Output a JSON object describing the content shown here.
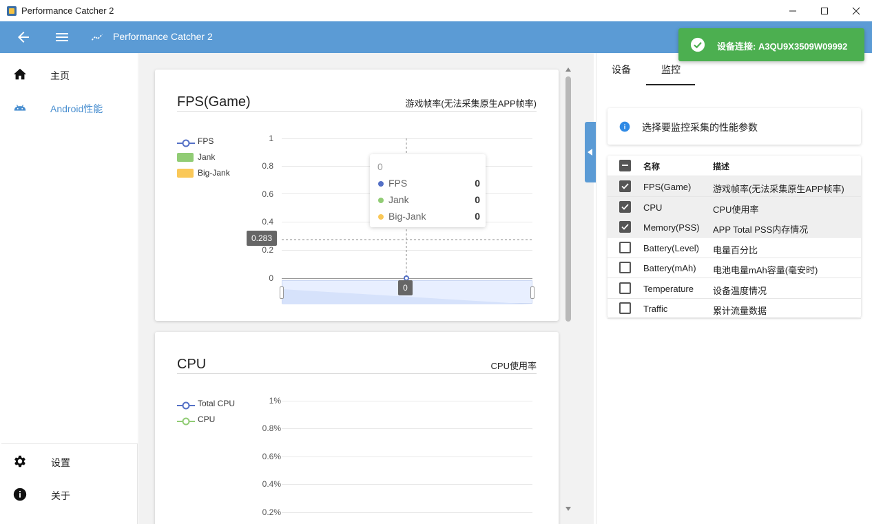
{
  "window": {
    "title": "Performance Catcher 2"
  },
  "appbar": {
    "title": "Performance Catcher 2"
  },
  "sidebar": {
    "items": [
      {
        "label": "主页",
        "icon": "home-icon"
      },
      {
        "label": "Android性能",
        "icon": "android-icon"
      }
    ],
    "bottom_items": [
      {
        "label": "设置",
        "icon": "gear-icon"
      },
      {
        "label": "关于",
        "icon": "info-icon"
      }
    ]
  },
  "fps_card": {
    "title": "FPS(Game)",
    "subtitle": "游戏帧率(无法采集原生APP帧率)",
    "legend": [
      "FPS",
      "Jank",
      "Big-Jank"
    ],
    "tooltip": {
      "header": "0",
      "rows": [
        {
          "name": "FPS",
          "value": "0"
        },
        {
          "name": "Jank",
          "value": "0"
        },
        {
          "name": "Big-Jank",
          "value": "0"
        }
      ]
    },
    "y_pointer_label": "0.283",
    "x_pointer_label": "0"
  },
  "cpu_card": {
    "title": "CPU",
    "subtitle": "CPU使用率",
    "legend": [
      "Total CPU",
      "CPU"
    ]
  },
  "chart_data": [
    {
      "type": "line",
      "title": "FPS(Game)",
      "subtitle": "游戏帧率(无法采集原生APP帧率)",
      "ylim": [
        0,
        1
      ],
      "yticks": [
        "1",
        "0.8",
        "0.6",
        "0.4",
        "0.2",
        "0"
      ],
      "series": [
        {
          "name": "FPS",
          "values": [
            0
          ]
        },
        {
          "name": "Jank",
          "values": [
            0
          ]
        },
        {
          "name": "Big-Jank",
          "values": [
            0
          ]
        }
      ],
      "x": [
        "0"
      ]
    },
    {
      "type": "line",
      "title": "CPU",
      "subtitle": "CPU使用率",
      "ylim": [
        0,
        1
      ],
      "yticks": [
        "1%",
        "0.8%",
        "0.6%",
        "0.4%",
        "0.2%"
      ],
      "series": [
        {
          "name": "Total CPU",
          "values": []
        },
        {
          "name": "CPU",
          "values": []
        }
      ]
    }
  ],
  "right_panel": {
    "tabs": [
      "设备",
      "监控"
    ],
    "active_tab": "监控",
    "info_text": "选择要监控采集的性能参数",
    "table": {
      "headers": {
        "name": "名称",
        "desc": "描述"
      },
      "rows": [
        {
          "name": "FPS(Game)",
          "desc": "游戏帧率(无法采集原生APP帧率)",
          "checked": true
        },
        {
          "name": "CPU",
          "desc": "CPU使用率",
          "checked": true
        },
        {
          "name": "Memory(PSS)",
          "desc": "APP Total PSS内存情况",
          "checked": true
        },
        {
          "name": "Battery(Level)",
          "desc": "电量百分比",
          "checked": false
        },
        {
          "name": "Battery(mAh)",
          "desc": "电池电量mAh容量(毫安时)",
          "checked": false
        },
        {
          "name": "Temperature",
          "desc": "设备温度情况",
          "checked": false
        },
        {
          "name": "Traffic",
          "desc": "累计流量数据",
          "checked": false
        }
      ]
    }
  },
  "toast": {
    "text": "设备连接: A3QU9X3509W09992"
  },
  "colors": {
    "appbar": "#5b9bd5",
    "accent": "#4a8fd0",
    "fps_series": "#5470c6",
    "jank_series": "#91cc75",
    "bigjank_series": "#fac858",
    "toast": "#4caf50"
  }
}
